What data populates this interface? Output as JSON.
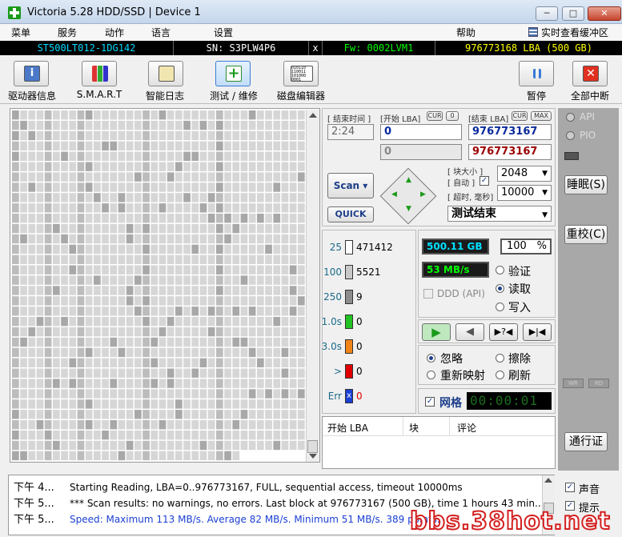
{
  "window": {
    "title": "Victoria 5.28 HDD/SSD | Device 1",
    "minimize": "─",
    "maximize": "□",
    "close": "✕"
  },
  "menu": {
    "items": [
      "菜单",
      "服务",
      "动作",
      "语言",
      "设置",
      "帮助"
    ],
    "right_label": "实时查看缓冲区"
  },
  "device": {
    "model": "ST500LT012-1DG142",
    "serial": "SN: S3PLW4P6",
    "sep": "x",
    "firmware": "Fw: 0002LVM1",
    "capacity": "976773168 LBA (500 GB)"
  },
  "toolbar": {
    "buttons": [
      {
        "label": "驱动器信息",
        "icon": "info-icon"
      },
      {
        "label": "S.M.A.R.T",
        "icon": "smart-icon"
      },
      {
        "label": "智能日志",
        "icon": "log-icon"
      },
      {
        "label": "测试 / 维修",
        "icon": "test-icon"
      },
      {
        "label": "磁盘编辑器",
        "icon": "binary-icon"
      }
    ],
    "binary_text": "010110\n110011\n101000\n0001",
    "pause": "暂停",
    "abort": "全部中断"
  },
  "range": {
    "end_time_label": "[ 结束时间 ]",
    "start_lba_label": "[开始 LBA]",
    "cur_label": "CUR",
    "zero_label": "0",
    "end_lba_label": "[结束 LBA]",
    "cur2": "CUR",
    "max": "MAX",
    "time": "2:24",
    "start_lba": "0",
    "end_lba": "976773167",
    "start_lba2": "0",
    "end_lba2": "976773167"
  },
  "scan": {
    "scan_button": "Scan",
    "quick_button": "QUICK",
    "block_size_label": "[ 块大小 ]",
    "auto_label": "[ 自动 ]",
    "auto_check": "✓",
    "timeout_label": "[ 超时, 毫秒]",
    "block_size": "2048",
    "timeout": "10000",
    "status": "测试结束"
  },
  "legend": [
    {
      "label": "25",
      "count": "471412",
      "color": "#ffffff"
    },
    {
      "label": "100",
      "count": "5521",
      "color": "#c8c8c8"
    },
    {
      "label": "250",
      "count": "9",
      "color": "#8c8c8c"
    },
    {
      "label": "1.0s",
      "count": "0",
      "color": "#22c322"
    },
    {
      "label": "3.0s",
      "count": "0",
      "color": "#f08418"
    },
    {
      "label": ">",
      "count": "0",
      "color": "#e00000"
    },
    {
      "label": "Err",
      "count": "0",
      "color": "#1a3fd4",
      "glyph": "x"
    }
  ],
  "stats": {
    "scanned": "500.11 GB",
    "percent": "100",
    "percent_sign": "%",
    "speed": "53 MB/s",
    "ddd": "DDD (API)",
    "verify": "验证",
    "read": "读取",
    "write": "写入"
  },
  "actions": {
    "ignore": "忽略",
    "erase": "擦除",
    "remap": "重新映射",
    "refresh": "刷新",
    "grid_label": "网格",
    "grid_check": "✓",
    "timer": "00:00:01"
  },
  "table": {
    "columns": [
      "开始 LBA",
      "块",
      "评论"
    ]
  },
  "side": {
    "api": "API",
    "pio": "PIO",
    "sleep": "睡眠(S)",
    "recal": "重校(C)",
    "wr": "WR",
    "rd": "RD",
    "passthrough": "通行证",
    "sound": "声音",
    "hints": "提示",
    "check": "✓"
  },
  "log": [
    {
      "time": "下午 4...",
      "text": "Starting Reading, LBA=0..976773167, FULL, sequential access, timeout 10000ms",
      "color": "#000000"
    },
    {
      "time": "下午 5...",
      "text": "*** Scan results: no warnings, no errors.  Last block at 976773167 (500 GB), time 1 hours 43 min...",
      "color": "#000000"
    },
    {
      "time": "下午 5...",
      "text": "Speed: Maximum 113 MB/s. Average 82 MB/s. Minimum 51 MB/s. 389 points.",
      "color": "#1a3fd4"
    }
  ],
  "watermark": "bbs.38hot.net",
  "colors": {
    "accent_green": "#00ff00",
    "capacity_yellow": "#ffff00",
    "lba_blue": "#0a2a9c",
    "lba_red": "#9c0000"
  }
}
